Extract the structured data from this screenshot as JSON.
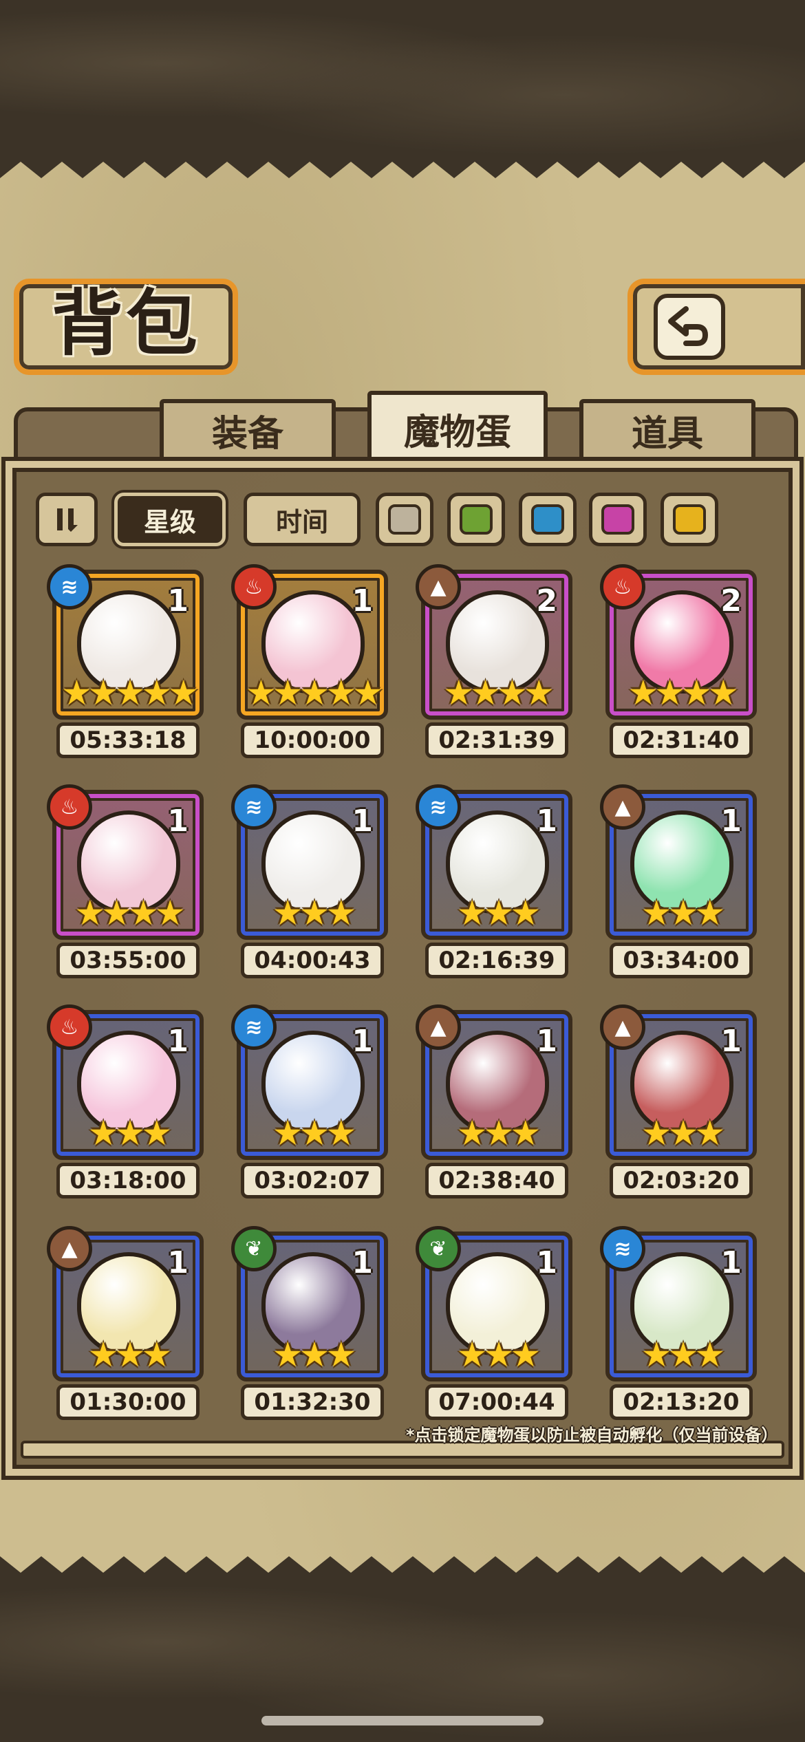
{
  "title": "背包",
  "back_icon": "return-arrow-icon",
  "tabs": [
    {
      "label": "装备",
      "active": false
    },
    {
      "label": "魔物蛋",
      "active": true
    },
    {
      "label": "道具",
      "active": false
    }
  ],
  "filters": {
    "sort_icon": "sort-toggle-icon",
    "star_label": "星级",
    "time_label": "时间",
    "swatches": [
      "#bdb29c",
      "#6ea233",
      "#2e8fc8",
      "#c743a6",
      "#e6b21d"
    ]
  },
  "element_icons": {
    "water": {
      "icon": "water-wave-icon",
      "color": "#2a86d6",
      "glyph": "≋"
    },
    "fire": {
      "icon": "flame-icon",
      "color": "#d63a2a",
      "glyph": "♨"
    },
    "earth": {
      "icon": "mountain-icon",
      "color": "#8c5a3c",
      "glyph": "▲"
    },
    "wood": {
      "icon": "leaf-icon",
      "color": "#3f8a3a",
      "glyph": "❦"
    }
  },
  "rarity_colors": {
    "gold": "#f5a623",
    "purple": "#c94fc8",
    "blue": "#3b5bd6"
  },
  "eggs": [
    {
      "element": "water",
      "rarity": "gold",
      "count": "1",
      "stars": 5,
      "time": "05:33:18",
      "egg_color": "#efe9e4"
    },
    {
      "element": "fire",
      "rarity": "gold",
      "count": "1",
      "stars": 5,
      "time": "10:00:00",
      "egg_color": "#f4c4d3"
    },
    {
      "element": "earth",
      "rarity": "purple",
      "count": "2",
      "stars": 4,
      "time": "02:31:39",
      "egg_color": "#e8e2dc"
    },
    {
      "element": "fire",
      "rarity": "purple",
      "count": "2",
      "stars": 4,
      "time": "02:31:40",
      "egg_color": "#f07aa8"
    },
    {
      "element": "fire",
      "rarity": "purple",
      "count": "1",
      "stars": 4,
      "time": "03:55:00",
      "egg_color": "#f2c8d6"
    },
    {
      "element": "water",
      "rarity": "blue",
      "count": "1",
      "stars": 3,
      "time": "04:00:43",
      "egg_color": "#efedea"
    },
    {
      "element": "water",
      "rarity": "blue",
      "count": "1",
      "stars": 3,
      "time": "02:16:39",
      "egg_color": "#e6e6de"
    },
    {
      "element": "earth",
      "rarity": "blue",
      "count": "1",
      "stars": 3,
      "time": "03:34:00",
      "egg_color": "#8fe3b0"
    },
    {
      "element": "fire",
      "rarity": "blue",
      "count": "1",
      "stars": 3,
      "time": "03:18:00",
      "egg_color": "#f6c6dc"
    },
    {
      "element": "water",
      "rarity": "blue",
      "count": "1",
      "stars": 3,
      "time": "03:02:07",
      "egg_color": "#c9d6ee"
    },
    {
      "element": "earth",
      "rarity": "blue",
      "count": "1",
      "stars": 3,
      "time": "02:38:40",
      "egg_color": "#b56c7a"
    },
    {
      "element": "earth",
      "rarity": "blue",
      "count": "1",
      "stars": 3,
      "time": "02:03:20",
      "egg_color": "#c65e5e"
    },
    {
      "element": "earth",
      "rarity": "blue",
      "count": "1",
      "stars": 3,
      "time": "01:30:00",
      "egg_color": "#f2e6b0"
    },
    {
      "element": "wood",
      "rarity": "blue",
      "count": "1",
      "stars": 3,
      "time": "01:32:30",
      "egg_color": "#8d7a9c"
    },
    {
      "element": "wood",
      "rarity": "blue",
      "count": "1",
      "stars": 3,
      "time": "07:00:44",
      "egg_color": "#f3f0d8"
    },
    {
      "element": "water",
      "rarity": "blue",
      "count": "1",
      "stars": 3,
      "time": "02:13:20",
      "egg_color": "#d8e8c8"
    }
  ],
  "footer_note": "*点击锁定魔物蛋以防止被自动孵化（仅当前设备）"
}
